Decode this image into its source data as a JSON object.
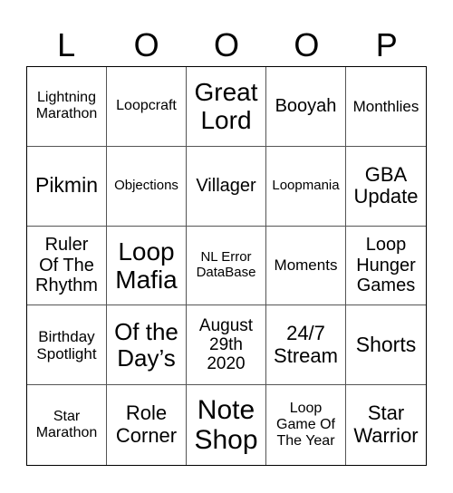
{
  "header": {
    "letters": [
      "L",
      "O",
      "O",
      "O",
      "P"
    ]
  },
  "board": {
    "cells": [
      {
        "text": "Lightning\nMarathon"
      },
      {
        "text": "Loopcraft"
      },
      {
        "text": "Great\nLord"
      },
      {
        "text": "Booyah"
      },
      {
        "text": "Monthlies"
      },
      {
        "text": "Pikmin"
      },
      {
        "text": "Objections"
      },
      {
        "text": "Villager"
      },
      {
        "text": "Loopmania"
      },
      {
        "text": "GBA\nUpdate"
      },
      {
        "text": "Ruler\nOf The\nRhythm"
      },
      {
        "text": "Loop\nMafia"
      },
      {
        "text": "NL Error\nDataBase"
      },
      {
        "text": "Moments"
      },
      {
        "text": "Loop\nHunger\nGames"
      },
      {
        "text": "Birthday\nSpotlight"
      },
      {
        "text": "Of the\nDay’s"
      },
      {
        "text": "August\n29th\n2020"
      },
      {
        "text": "24/7\nStream"
      },
      {
        "text": "Shorts"
      },
      {
        "text": "Star\nMarathon"
      },
      {
        "text": "Role\nCorner"
      },
      {
        "text": "Note\nShop"
      },
      {
        "text": "Loop\nGame Of\nThe Year"
      },
      {
        "text": "Star\nWarrior"
      }
    ]
  }
}
